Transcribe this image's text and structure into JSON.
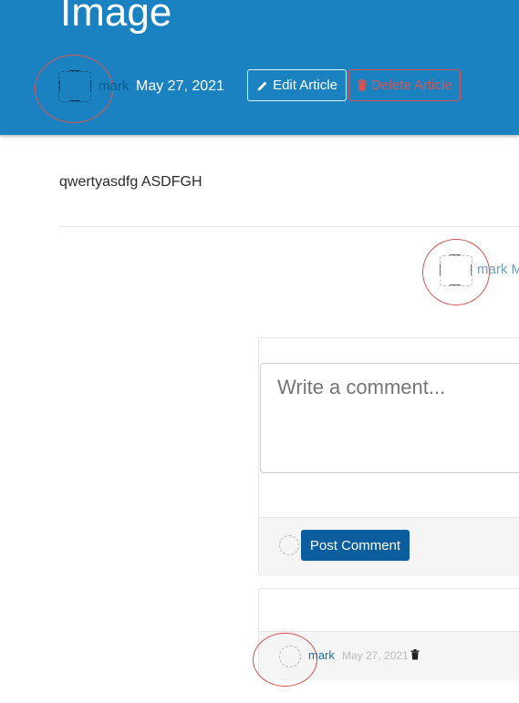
{
  "article": {
    "title": "Image",
    "author": "mark",
    "date": "May 27, 2021",
    "edit_label": "Edit Article",
    "delete_label": "Delete Article",
    "body": "qwertyasdfg ASDFGH"
  },
  "article_meta_bottom": {
    "author": "mark M"
  },
  "comment_form": {
    "placeholder": "Write a comment...",
    "post_label": "Post Comment"
  },
  "comments": [
    {
      "author": "mark",
      "date": "May 27, 2021"
    }
  ],
  "colors": {
    "banner": "#1b82c1",
    "primary_button": "#0b5d9e",
    "danger": "#d9534f"
  }
}
